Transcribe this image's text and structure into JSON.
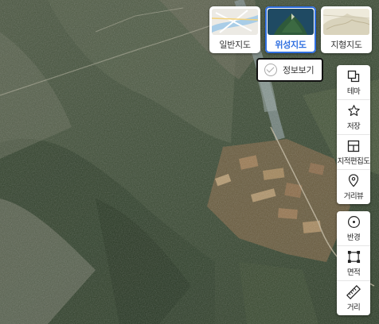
{
  "map_types": [
    {
      "label": "일반지도",
      "icon": "general-map-thumbnail"
    },
    {
      "label": "위성지도",
      "icon": "satellite-map-thumbnail",
      "selected": true
    },
    {
      "label": "지형지도",
      "icon": "terrain-map-thumbnail"
    }
  ],
  "info_toggle": {
    "label": "정보보기",
    "checked": false
  },
  "tools": [
    {
      "label": "테마",
      "icon": "layers-icon"
    },
    {
      "label": "저장",
      "icon": "star-icon"
    },
    {
      "label": "지적편집도",
      "icon": "cadastral-grid-icon"
    },
    {
      "label": "거리뷰",
      "icon": "street-view-pin-icon"
    }
  ],
  "measure_tools": [
    {
      "label": "반경",
      "icon": "radius-icon"
    },
    {
      "label": "면적",
      "icon": "area-icon"
    },
    {
      "label": "거리",
      "icon": "ruler-icon"
    }
  ],
  "colors": {
    "accent": "#2f6fe0",
    "forest": "#34442c",
    "farmland": "#8a6a48",
    "river": "#7f908e"
  }
}
